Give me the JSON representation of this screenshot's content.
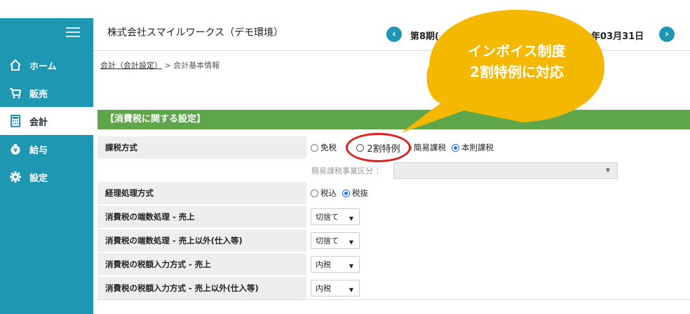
{
  "sidebar": {
    "items": [
      {
        "label": "ホーム",
        "icon": "home-icon"
      },
      {
        "label": "販売",
        "icon": "cart-icon"
      },
      {
        "label": "会計",
        "icon": "calculator-icon"
      },
      {
        "label": "給与",
        "icon": "yen-bag-icon"
      },
      {
        "label": "設定",
        "icon": "gear-icon"
      }
    ],
    "active_index": 2
  },
  "header": {
    "company": "株式会社スマイルワークス（デモ環境）",
    "period_left": "第8期(",
    "period_right": "年03月31日"
  },
  "breadcrumb": {
    "link": "会計（会計設定）",
    "current": " > 会計基本情報"
  },
  "section": {
    "title": "【消費税に関する設定】"
  },
  "form": {
    "tax_method": {
      "label": "課税方式",
      "options": [
        "免税",
        "2割特例",
        "簡易課税",
        "本則課税"
      ],
      "selected": "本則課税"
    },
    "simple_category": {
      "label": "簡易課税事業区分 ："
    },
    "accounting_method": {
      "label": "経理処理方式",
      "options": [
        "税込",
        "税抜"
      ],
      "selected": "税抜"
    },
    "rows": [
      {
        "label": "消費税の端数処理 - 売上",
        "value": "切捨て"
      },
      {
        "label": "消費税の端数処理 - 売上以外(仕入等)",
        "value": "切捨て"
      },
      {
        "label": "消費税の税額入力方式 - 売上",
        "value": "内税"
      },
      {
        "label": "消費税の税額入力方式 - 売上以外(仕入等)",
        "value": "内税"
      }
    ]
  },
  "callout": {
    "line1": "インボイス制度",
    "line2": "2割特例に対応",
    "color": "#f5b800"
  },
  "colors": {
    "sidebar": "#1e97b3",
    "section": "#5fa54a",
    "highlight": "#e02020"
  }
}
